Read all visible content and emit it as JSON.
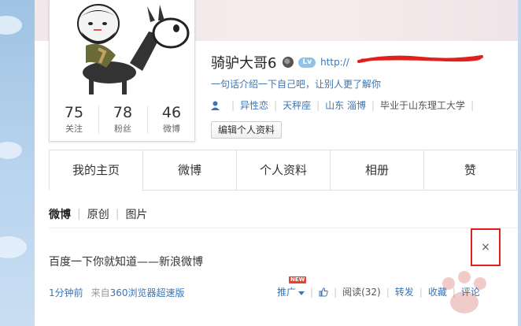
{
  "profile": {
    "nickname": "骑驴大哥6",
    "level_badge": "Lv",
    "url_partial": "http://",
    "intro": "一句话介绍一下自己吧，让别人更了解你",
    "tags": [
      "异性恋",
      "天秤座",
      "山东 淄博",
      "毕业于山东理工大学"
    ],
    "edit_button": "编辑个人资料"
  },
  "stats": [
    {
      "value": "75",
      "label": "关注"
    },
    {
      "value": "78",
      "label": "粉丝"
    },
    {
      "value": "46",
      "label": "微博"
    }
  ],
  "tabs": [
    "我的主页",
    "微博",
    "个人资料",
    "相册",
    "赞"
  ],
  "feed_filters": [
    "微博",
    "原创",
    "图片"
  ],
  "post": {
    "text": "百度一下你就知道——新浪微博",
    "time": "1分钟前",
    "source_prefix": "来自",
    "source": "360浏览器超速版",
    "close": "×",
    "new_tag": "NEW",
    "promote": "推广",
    "read": "阅读(32)",
    "forward": "转发",
    "favorite": "收藏",
    "comment": "评论"
  },
  "colors": {
    "link": "#3a75b8",
    "highlight_box": "#e0201c",
    "redaction_line": "#e0201c"
  }
}
